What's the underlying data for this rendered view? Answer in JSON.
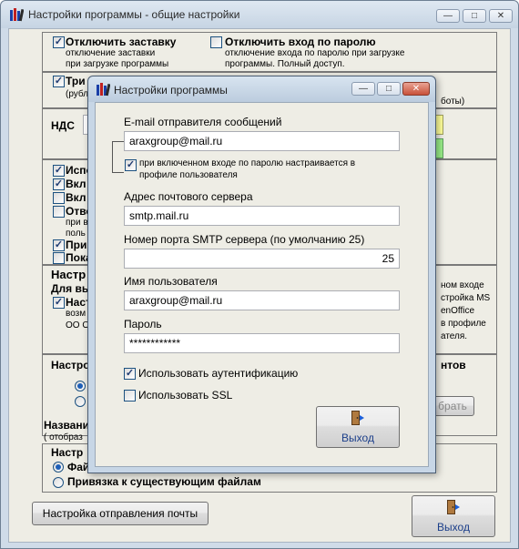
{
  "main_window": {
    "title": "Настройки программы - общие настройки",
    "opt_disable_splash": {
      "label": "Отключить заставку",
      "desc1": "отключение заставки",
      "desc2": "при загрузке программы",
      "checked": true
    },
    "opt_disable_password": {
      "label": "Отключить вход по паролю",
      "desc1": "отключение входа по паролю при загрузке",
      "desc2": "программы. Полный доступ.",
      "checked": false
    },
    "opt_three_frag": {
      "label": "Три",
      "desc": "(рубл",
      "right_text": "боты)",
      "checked": true
    },
    "vat_label": "НДС",
    "opt_list": [
      {
        "label": "Испо",
        "checked": true
      },
      {
        "label": "Вкл",
        "checked": true
      },
      {
        "label": "Вкл",
        "checked": false
      },
      {
        "label": "Отве",
        "desc1": "при в",
        "desc2": "поль",
        "checked": false
      },
      {
        "label": "При",
        "checked": true
      },
      {
        "label": "Пока",
        "checked": false
      }
    ],
    "section_settings_heading": "Настр",
    "section_settings_sub": "Для вы",
    "opt_setting_frag": {
      "label": "Наст",
      "desc1": "возм",
      "desc2": "ОО О",
      "checked": true
    },
    "right_texts": [
      "ном входе",
      "стройка MS",
      "enOffice",
      "в профиле",
      "ателя."
    ],
    "section_docs_heading": "Настро",
    "section_docs_right": "нтов",
    "select_button_label": "брать",
    "name_label": "Названи",
    "name_hint": "( отобраз",
    "section_files_heading": "Настр",
    "radio_files_first": "Фай",
    "radio_files_second": "Привязка к существующим файлам",
    "mail_settings_button": "Настройка отправления почты",
    "exit_button": "Выход"
  },
  "dialog": {
    "title": "Настройки программы",
    "email_label": "E-mail отправителя сообщений",
    "email_value": "araxgroup@mail.ru",
    "password_setting_text1": "при включенном входе по паролю настраивается в",
    "password_setting_text2": "профиле пользователя",
    "password_setting_checked": true,
    "server_label": "Адрес почтового сервера",
    "server_value": "smtp.mail.ru",
    "port_label": "Номер порта SMTP сервера (по умолчанию 25)",
    "port_value": "25",
    "username_label": "Имя пользователя",
    "username_value": "araxgroup@mail.ru",
    "password_label": "Пароль",
    "password_value": "************",
    "use_auth_label": "Использовать аутентификацию",
    "use_auth_checked": true,
    "use_ssl_label": "Использовать SSL",
    "use_ssl_checked": false,
    "exit_button": "Выход"
  },
  "window_controls": {
    "minimize": "—",
    "maximize": "□",
    "close": "✕"
  },
  "icons": {
    "app": "books-icon",
    "exit": "door-exit-icon"
  },
  "colors": {
    "title_bar": "#c6d4e3",
    "client_bg": "#eeede5",
    "close_red": "#c8513a",
    "exit_text": "#1c3f8a"
  }
}
